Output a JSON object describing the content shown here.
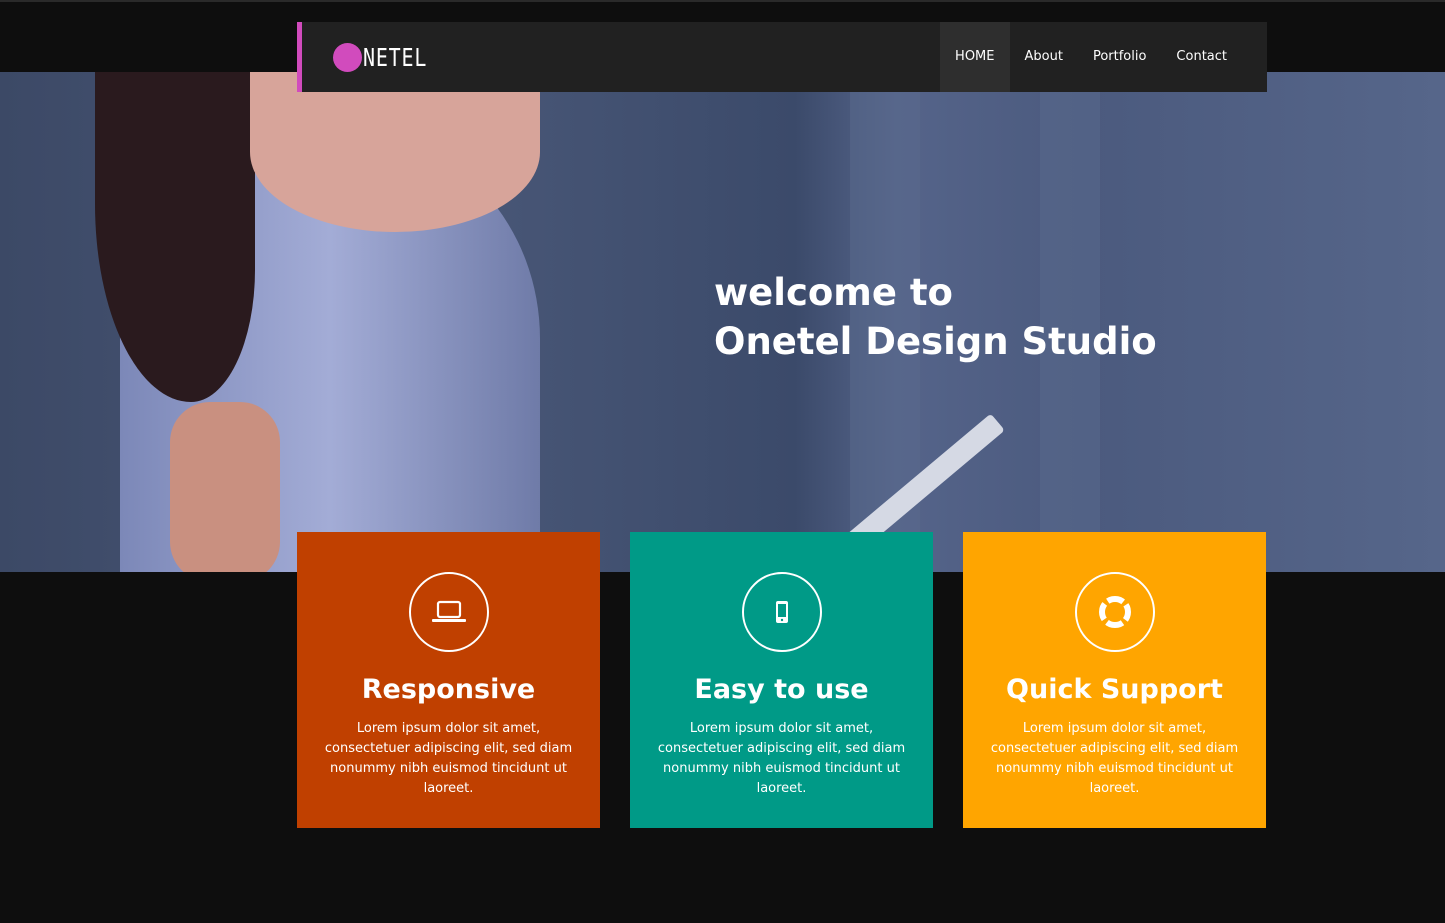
{
  "nav": {
    "logo": "NETEL",
    "logo_color": "#d14bbd",
    "items": [
      {
        "label": "HOME",
        "active": true
      },
      {
        "label": "About"
      },
      {
        "label": "Portfolio"
      },
      {
        "label": "Contact"
      }
    ]
  },
  "hero": {
    "line1": "welcome to",
    "line2": "Onetel Design Studio"
  },
  "features": [
    {
      "title": "Responsive",
      "icon": "laptop-icon",
      "color": "#c04000",
      "text": "Lorem ipsum dolor sit amet, consectetuer adipiscing elit, sed diam nonummy nibh euismod tincidunt ut laoreet."
    },
    {
      "title": "Easy to use",
      "icon": "mobile-icon",
      "color": "#009a87",
      "text": "Lorem ipsum dolor sit amet, consectetuer adipiscing elit, sed diam nonummy nibh euismod tincidunt ut laoreet."
    },
    {
      "title": "Quick Support",
      "icon": "lifebuoy-icon",
      "color": "#ffa500",
      "text": "Lorem ipsum dolor sit amet, consectetuer adipiscing elit, sed diam nonummy nibh euismod tincidunt ut laoreet."
    }
  ]
}
